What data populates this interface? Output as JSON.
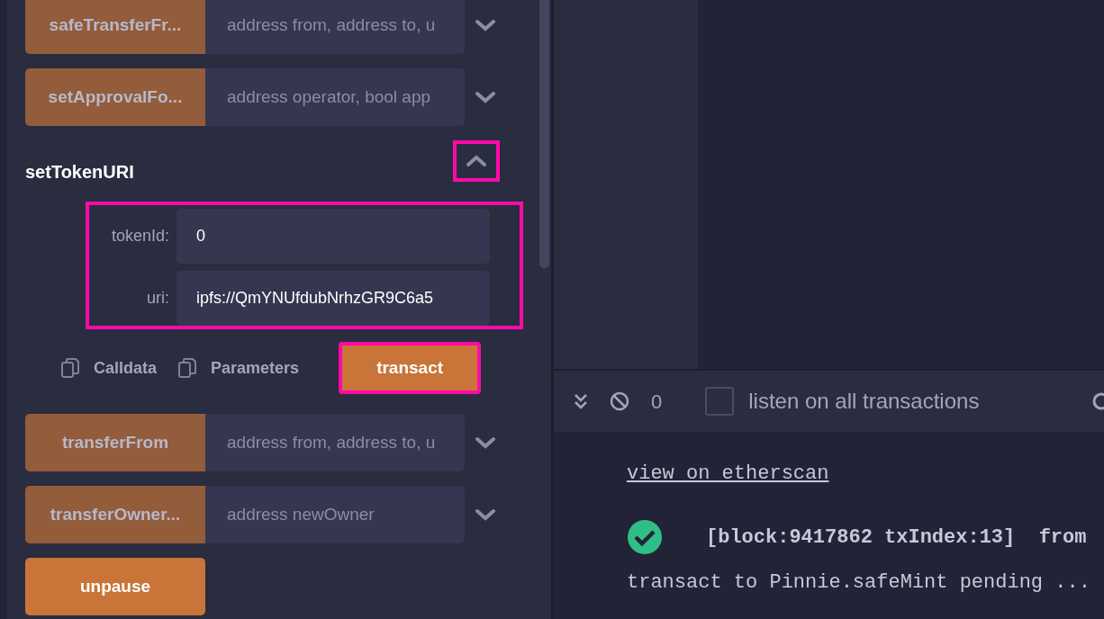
{
  "functions": [
    {
      "name": "safeTransferFr...",
      "dimmed": true,
      "placeholder": "address from, address to, u",
      "expanded": false
    },
    {
      "name": "setApprovalFo...",
      "dimmed": true,
      "placeholder": "address operator, bool app",
      "expanded": false
    },
    {
      "name": "setTokenURI",
      "expanded": true,
      "toggle_highlighted": true,
      "params_highlighted": true,
      "params": [
        {
          "label": "tokenId:",
          "value": "0"
        },
        {
          "label": "uri:",
          "value": "ipfs://QmYNUfdubNrhzGR9C6a5"
        }
      ],
      "actions": [
        {
          "label": "Calldata"
        },
        {
          "label": "Parameters"
        }
      ],
      "submit": {
        "label": "transact",
        "highlighted": true
      }
    },
    {
      "name": "transferFrom",
      "dimmed": true,
      "placeholder": "address from, address to, u",
      "expanded": false
    },
    {
      "name": "transferOwner...",
      "dimmed": true,
      "placeholder": "address newOwner",
      "expanded": false
    },
    {
      "name": "unpause",
      "dimmed": false
    }
  ],
  "terminal": {
    "count": "0",
    "listen_all": {
      "label": "listen on all transactions",
      "checked": false
    },
    "log": [
      {
        "kind": "link",
        "text": "view on etherscan"
      },
      {
        "kind": "success",
        "text": "[block:9417862 txIndex:13]  from"
      },
      {
        "kind": "plain",
        "text": "transact to Pinnie.safeMint pending ..."
      }
    ]
  }
}
